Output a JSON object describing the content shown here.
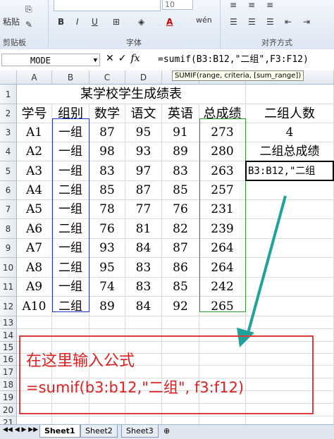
{
  "ribbon": {
    "paste_label": "粘贴",
    "clipboard_label": "剪贴板",
    "font_group_label": "字体",
    "align_group_label": "对齐方式",
    "font_size": "10",
    "bold": "B",
    "italic": "I",
    "underline": "U",
    "increase_font": "A",
    "decrease_font": "A",
    "font_color": "A",
    "phonetic": "wén"
  },
  "formula_bar": {
    "name_box": "MODE",
    "formula": "=sumif(B3:B12,\"二组\",F3:F12)",
    "tooltip": "SUMIF(range, criteria, [sum_range])"
  },
  "columns": [
    "A",
    "B",
    "C",
    "D",
    "E",
    "F",
    "G"
  ],
  "rows": [
    "1",
    "2",
    "3",
    "4",
    "5",
    "6",
    "7",
    "8",
    "9",
    "10",
    "11",
    "12",
    "13",
    "14",
    "15",
    "16",
    "17",
    "18",
    "19",
    "20",
    "21"
  ],
  "sheet": {
    "title": "某学校学生成绩表",
    "headers": [
      "学号",
      "组别",
      "数学",
      "语文",
      "英语",
      "总成绩"
    ],
    "data": [
      [
        "A1",
        "一组",
        "87",
        "95",
        "91",
        "273"
      ],
      [
        "A2",
        "一组",
        "98",
        "93",
        "89",
        "280"
      ],
      [
        "A3",
        "一组",
        "83",
        "97",
        "83",
        "263"
      ],
      [
        "A4",
        "二组",
        "85",
        "87",
        "85",
        "257"
      ],
      [
        "A5",
        "一组",
        "78",
        "77",
        "76",
        "231"
      ],
      [
        "A6",
        "二组",
        "76",
        "81",
        "82",
        "239"
      ],
      [
        "A7",
        "一组",
        "93",
        "84",
        "87",
        "264"
      ],
      [
        "A8",
        "二组",
        "95",
        "83",
        "86",
        "264"
      ],
      [
        "A9",
        "一组",
        "74",
        "83",
        "85",
        "242"
      ],
      [
        "A10",
        "二组",
        "89",
        "84",
        "92",
        "265"
      ]
    ],
    "g2": "二组人数",
    "g3": "4",
    "g4": "二组总成绩",
    "g5": "B3:B12,\"二组"
  },
  "annotation": {
    "line1": "在这里输入公式",
    "line2": "=sumif(b3:b12,\"二组\", f3:f12)"
  },
  "tabs": [
    "Sheet1",
    "Sheet2",
    "Sheet3"
  ],
  "colors": {
    "arrow": "#1fa39a",
    "annot": "#e03a3a",
    "blue_range": "#2233cc",
    "green_range": "#2a9a2a"
  }
}
